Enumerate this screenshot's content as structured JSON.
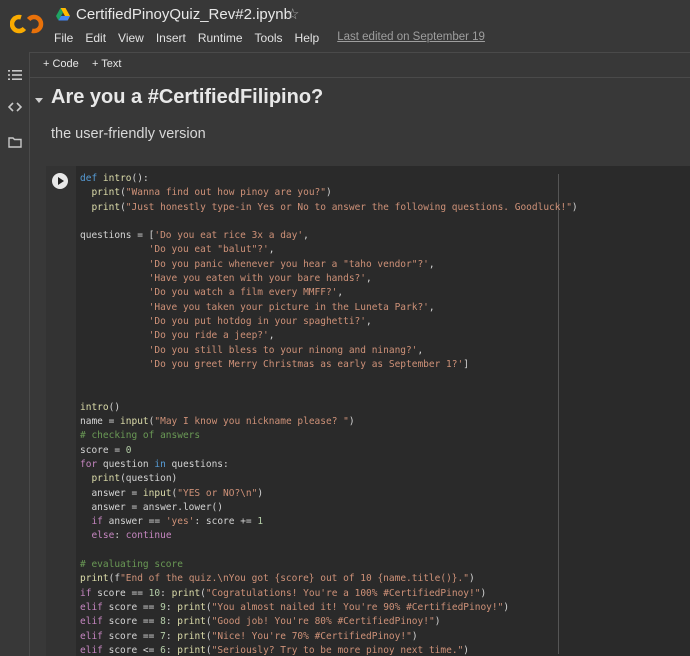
{
  "app": {
    "notebook_title": "CertifiedPinoyQuiz_Rev#2.ipynb",
    "menu": [
      "File",
      "Edit",
      "View",
      "Insert",
      "Runtime",
      "Tools",
      "Help"
    ],
    "last_edited": "Last edited on September 19",
    "logo_text": "CO",
    "accent_color": "#f9ab00"
  },
  "toolbar": {
    "add_code": "+ Code",
    "add_text": "+ Text"
  },
  "sidebar": {
    "icons": [
      "menu-icon",
      "code-icon",
      "folder-icon"
    ]
  },
  "notebook": {
    "heading": "Are you a #CertifiedFilipino?",
    "subheading": "the user-friendly version",
    "code_lines": [
      "def intro():",
      "  print(\"Wanna find out how pinoy are you?\")",
      "  print(\"Just honestly type-in Yes or No to answer the following questions. Goodluck!\")",
      "",
      "questions = ['Do you eat rice 3x a day',",
      "            'Do you eat \"balut\"?',",
      "            'Do you panic whenever you hear a \"taho vendor\"?',",
      "            'Have you eaten with your bare hands?',",
      "            'Do you watch a film every MMFF?',",
      "            'Have you taken your picture in the Luneta Park?',",
      "            'Do you put hotdog in your spaghetti?',",
      "            'Do you ride a jeep?',",
      "            'Do you still bless to your ninong and ninang?',",
      "            'Do you greet Merry Christmas as early as September 1?']",
      "",
      "",
      "intro()",
      "name = input(\"May I know you nickname please? \")",
      "# checking of answers",
      "score = 0",
      "for question in questions:",
      "  print(question)",
      "  answer = input(\"YES or NO?\\n\")",
      "  answer = answer.lower()",
      "  if answer == 'yes': score += 1",
      "  else: continue",
      "",
      "# evaluating score",
      "print(f\"End of the quiz.\\nYou got {score} out of 10 {name.title()}.\")",
      "if score == 10: print(\"Cogratulations! You're a 100% #CertifiedPinoy!\")",
      "elif score == 9: print(\"You almost nailed it! You're 90% #CertifiedPinoy!\")",
      "elif score == 8: print(\"Good job! You're 80% #CertifiedPinoy!\")",
      "elif score == 7: print(\"Nice! You're 70% #CertifiedPinoy!\")",
      "elif score <= 6: print(\"Seriously? Try to be more pinoy next time.\")"
    ]
  }
}
